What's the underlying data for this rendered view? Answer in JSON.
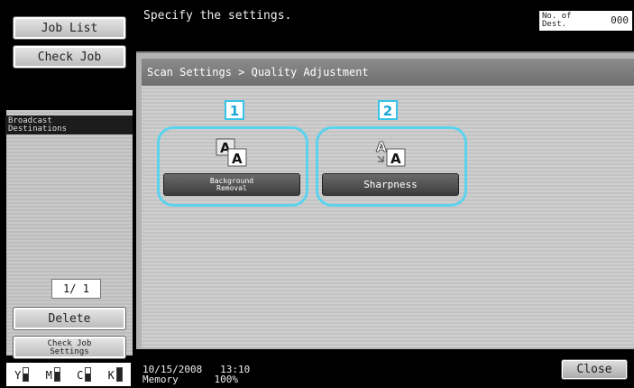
{
  "sidebar": {
    "job_list": "Job List",
    "check_job": "Check Job",
    "broadcast": "Broadcast\nDestinations",
    "page": "1/ 1",
    "delete": "Delete",
    "check_job_settings": "Check Job\nSettings",
    "toner": [
      {
        "label": "Y",
        "level": 0.6
      },
      {
        "label": "M",
        "level": 0.7
      },
      {
        "label": "C",
        "level": 0.6
      },
      {
        "label": "K",
        "level": 1.0
      }
    ]
  },
  "header": {
    "message": "Specify the settings.",
    "dest_label": "No. of\nDest.",
    "dest_value": "000"
  },
  "main": {
    "breadcrumb": "Scan Settings > Quality Adjustment",
    "options": [
      {
        "number": "1",
        "label": "Background\nRemoval",
        "icon": "background-removal-icon"
      },
      {
        "number": "2",
        "label": "Sharpness",
        "icon": "sharpness-icon"
      }
    ]
  },
  "footer": {
    "date": "10/15/2008",
    "time": "13:10",
    "memory_label": "Memory",
    "memory_value": "100%",
    "close": "Close"
  },
  "colors": {
    "highlight": "#5bd3ee",
    "number": "#1aa7d8"
  }
}
